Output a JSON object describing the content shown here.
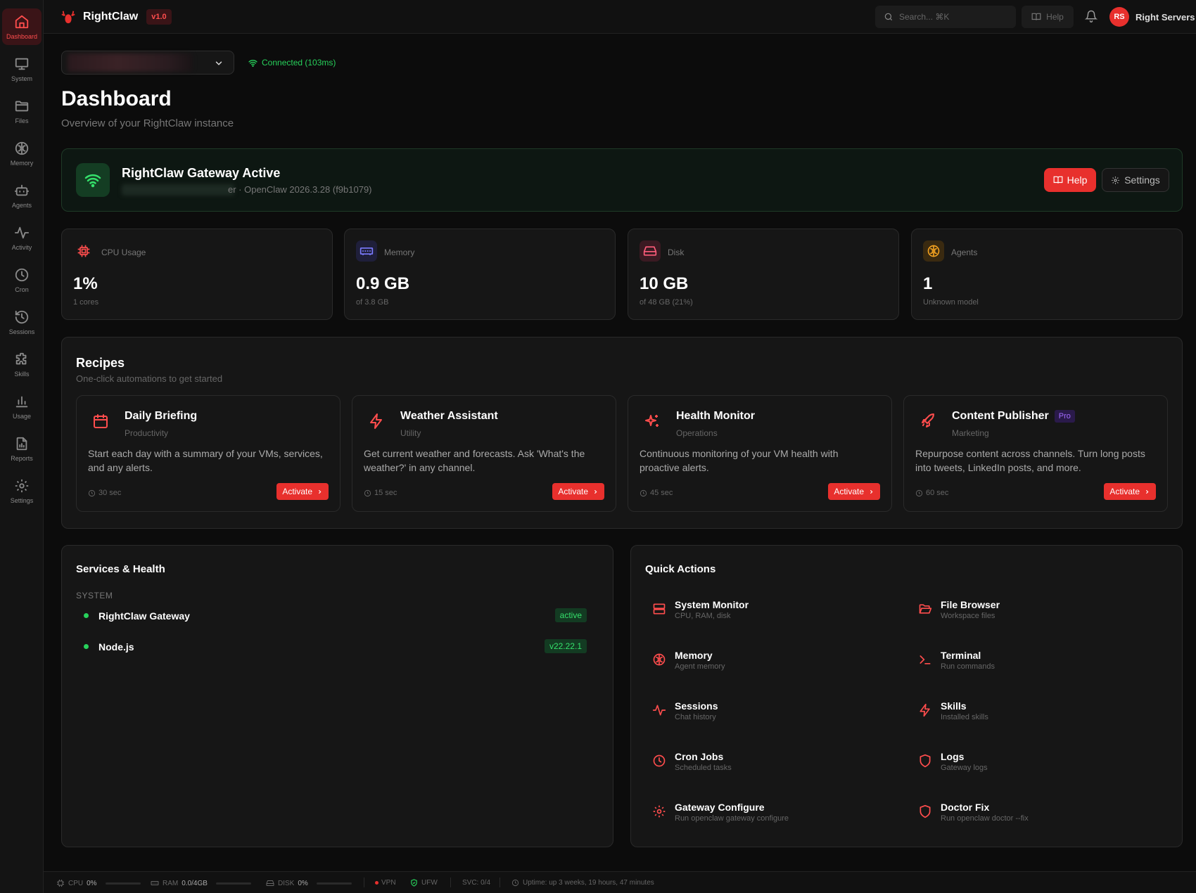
{
  "sidebar": {
    "items": [
      {
        "label": "Dashboard",
        "icon": "home-icon",
        "active": true
      },
      {
        "label": "System",
        "icon": "monitor-icon"
      },
      {
        "label": "Files",
        "icon": "folder-icon"
      },
      {
        "label": "Memory",
        "icon": "brain-icon"
      },
      {
        "label": "Agents",
        "icon": "bot-icon"
      },
      {
        "label": "Activity",
        "icon": "activity-icon"
      },
      {
        "label": "Cron",
        "icon": "clock-icon"
      },
      {
        "label": "Sessions",
        "icon": "history-icon"
      },
      {
        "label": "Skills",
        "icon": "puzzle-icon"
      },
      {
        "label": "Usage",
        "icon": "bar-chart-icon"
      },
      {
        "label": "Reports",
        "icon": "report-icon"
      },
      {
        "label": "Settings",
        "icon": "gear-icon"
      }
    ]
  },
  "topbar": {
    "brand": "RightClaw",
    "version": "v1.0",
    "search_placeholder": "Search... ⌘K",
    "help_label": "Help",
    "user_initials": "RS",
    "user_name": "Right Servers"
  },
  "connection": {
    "status": "Connected (103ms)"
  },
  "page": {
    "title": "Dashboard",
    "subtitle": "Overview of your RightClaw instance"
  },
  "gateway": {
    "title": "RightClaw Gateway Active",
    "subtitle": "er · OpenClaw 2026.3.28 (f9b1079)",
    "help_label": "Help",
    "settings_label": "Settings"
  },
  "stats": [
    {
      "label": "CPU Usage",
      "value": "1%",
      "sub": "1 cores",
      "icon": "cpu-icon",
      "color": "#ff4d4d",
      "bg": "#161616"
    },
    {
      "label": "Memory",
      "value": "0.9 GB",
      "sub": "of 3.8 GB",
      "icon": "memory-chip-icon",
      "color": "#7b7bff",
      "bg": "#1f1f3a"
    },
    {
      "label": "Disk",
      "value": "10 GB",
      "sub": "of 48 GB (21%)",
      "icon": "hard-drive-icon",
      "color": "#ff5c7a",
      "bg": "#3a1a22"
    },
    {
      "label": "Agents",
      "value": "1",
      "sub": "Unknown model",
      "icon": "brain-icon",
      "color": "#f0a020",
      "bg": "#3a2a10"
    }
  ],
  "recipes": {
    "title": "Recipes",
    "subtitle": "One-click automations to get started",
    "items": [
      {
        "title": "Daily Briefing",
        "category": "Productivity",
        "description": "Start each day with a summary of your VMs, services, and any alerts.",
        "time": "30 sec",
        "button": "Activate",
        "icon": "calendar-icon"
      },
      {
        "title": "Weather Assistant",
        "category": "Utility",
        "description": "Get current weather and forecasts. Ask 'What's the weather?' in any channel.",
        "time": "15 sec",
        "button": "Activate",
        "icon": "bolt-icon"
      },
      {
        "title": "Health Monitor",
        "category": "Operations",
        "description": "Continuous monitoring of your VM health with proactive alerts.",
        "time": "45 sec",
        "button": "Activate",
        "icon": "sparkles-icon"
      },
      {
        "title": "Content Publisher",
        "badge": "Pro",
        "category": "Marketing",
        "description": "Repurpose content across channels. Turn long posts into tweets, LinkedIn posts, and more.",
        "time": "60 sec",
        "button": "Activate",
        "icon": "rocket-icon"
      }
    ]
  },
  "services": {
    "title": "Services & Health",
    "group": "SYSTEM",
    "items": [
      {
        "name": "RightClaw Gateway",
        "badge": "active"
      },
      {
        "name": "Node.js",
        "badge": "v22.22.1"
      }
    ]
  },
  "quick_actions": {
    "title": "Quick Actions",
    "items": [
      {
        "title": "System Monitor",
        "sub": "CPU, RAM, disk",
        "icon": "server-icon"
      },
      {
        "title": "File Browser",
        "sub": "Workspace files",
        "icon": "folder-open-icon"
      },
      {
        "title": "Memory",
        "sub": "Agent memory",
        "icon": "brain-icon"
      },
      {
        "title": "Terminal",
        "sub": "Run commands",
        "icon": "terminal-icon"
      },
      {
        "title": "Sessions",
        "sub": "Chat history",
        "icon": "activity-icon"
      },
      {
        "title": "Skills",
        "sub": "Installed skills",
        "icon": "bolt-icon"
      },
      {
        "title": "Cron Jobs",
        "sub": "Scheduled tasks",
        "icon": "clock-icon"
      },
      {
        "title": "Logs",
        "sub": "Gateway logs",
        "icon": "shield-icon"
      },
      {
        "title": "Gateway Configure",
        "sub": "Run openclaw gateway configure",
        "icon": "gear-icon"
      },
      {
        "title": "Doctor Fix",
        "sub": "Run openclaw doctor --fix",
        "icon": "shield-icon"
      }
    ]
  },
  "statusbar": {
    "cpu_label": "CPU",
    "cpu_value": "0%",
    "ram_label": "RAM",
    "ram_value": "0.0/4GB",
    "disk_label": "DISK",
    "disk_value": "0%",
    "vpn_label": "VPN",
    "ufw_label": "UFW",
    "svc": "SVC: 0/4",
    "uptime": "Uptime: up 3 weeks, 19 hours, 47 minutes"
  },
  "colors": {
    "accent": "#e8302d",
    "success": "#27d15b",
    "pro": "#a36cff"
  }
}
